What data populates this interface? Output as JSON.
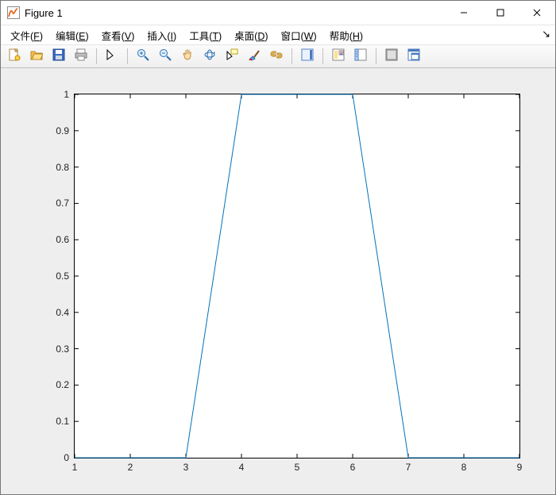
{
  "window": {
    "title": "Figure 1"
  },
  "menu": {
    "items": [
      {
        "label": "文件",
        "key": "F"
      },
      {
        "label": "编辑",
        "key": "E"
      },
      {
        "label": "查看",
        "key": "V"
      },
      {
        "label": "插入",
        "key": "I"
      },
      {
        "label": "工具",
        "key": "T"
      },
      {
        "label": "桌面",
        "key": "D"
      },
      {
        "label": "窗口",
        "key": "W"
      },
      {
        "label": "帮助",
        "key": "H"
      }
    ]
  },
  "toolbar": {
    "tools": [
      "new-figure",
      "open-file",
      "save",
      "print",
      "|",
      "edit-plot",
      "|",
      "zoom-in",
      "zoom-out",
      "pan",
      "rotate-3d",
      "data-cursor",
      "brush",
      "link",
      "|",
      "insert-colorbar",
      "|",
      "insert-legend",
      "hide-plot-tools",
      "|",
      "show-plot-tools",
      "dock-figure"
    ]
  },
  "chart_data": {
    "type": "line",
    "x": [
      1,
      2,
      3,
      4,
      5,
      6,
      7,
      8,
      9
    ],
    "y": [
      0,
      0,
      0,
      1,
      1,
      1,
      0,
      0,
      0
    ],
    "xlim": [
      1,
      9
    ],
    "ylim": [
      0,
      1
    ],
    "xticks": [
      1,
      2,
      3,
      4,
      5,
      6,
      7,
      8,
      9
    ],
    "yticks": [
      0,
      0.1,
      0.2,
      0.3,
      0.4,
      0.5,
      0.6,
      0.7,
      0.8,
      0.9,
      1
    ],
    "line_color": "#0072BD",
    "title": "",
    "xlabel": "",
    "ylabel": ""
  }
}
